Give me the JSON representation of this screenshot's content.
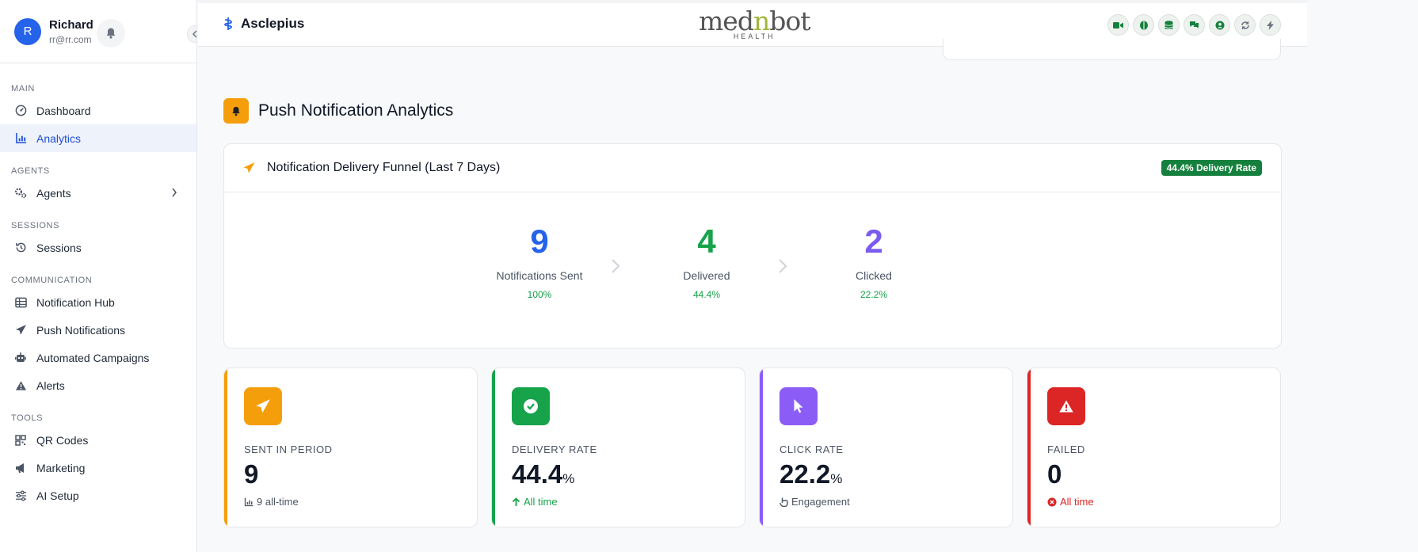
{
  "user": {
    "initial": "R",
    "name": "Richard",
    "email": "rr@rr.com"
  },
  "nav": {
    "main_label": "MAIN",
    "dashboard": "Dashboard",
    "analytics": "Analytics",
    "agents_label": "AGENTS",
    "agents": "Agents",
    "sessions_label": "SESSIONS",
    "sessions": "Sessions",
    "communication_label": "COMMUNICATION",
    "notification_hub": "Notification Hub",
    "push_notifications": "Push Notifications",
    "automated_campaigns": "Automated Campaigns",
    "alerts": "Alerts",
    "tools_label": "TOOLS",
    "qr_codes": "QR Codes",
    "marketing": "Marketing",
    "ai_setup": "AI Setup"
  },
  "header": {
    "app_name": "Asclepius",
    "logo_pre": "med",
    "logo_n": "n",
    "logo_post": "bot",
    "logo_sub": "HEALTH",
    "icons": [
      "video-icon",
      "brain-icon",
      "database-icon",
      "chat-icon",
      "user-circle-icon",
      "sync-icon",
      "bolt-icon"
    ]
  },
  "section": {
    "title": "Push Notification Analytics"
  },
  "funnel": {
    "title": "Notification Delivery Funnel (Last 7 Days)",
    "badge": "44.4% Delivery Rate",
    "stages": [
      {
        "value": "9",
        "label": "Notifications Sent",
        "pct": "100%",
        "color": "#2563eb"
      },
      {
        "value": "4",
        "label": "Delivered",
        "pct": "44.4%",
        "color": "#16a34a"
      },
      {
        "value": "2",
        "label": "Clicked",
        "pct": "22.2%",
        "color": "#7c5cf0"
      }
    ]
  },
  "stats": [
    {
      "label": "SENT IN PERIOD",
      "value": "9",
      "unit": "",
      "sub": "9 all-time",
      "accent": "#f59e0b",
      "sub_color": "#4b5563"
    },
    {
      "label": "DELIVERY RATE",
      "value": "44.4",
      "unit": "%",
      "sub": "All time",
      "accent": "#16a34a",
      "sub_color": "#16a34a"
    },
    {
      "label": "CLICK RATE",
      "value": "22.2",
      "unit": "%",
      "sub": "Engagement",
      "accent": "#8b5cf6",
      "sub_color": "#4b5563"
    },
    {
      "label": "FAILED",
      "value": "0",
      "unit": "",
      "sub": "All time",
      "accent": "#dc2626",
      "sub_color": "#dc2626"
    }
  ]
}
